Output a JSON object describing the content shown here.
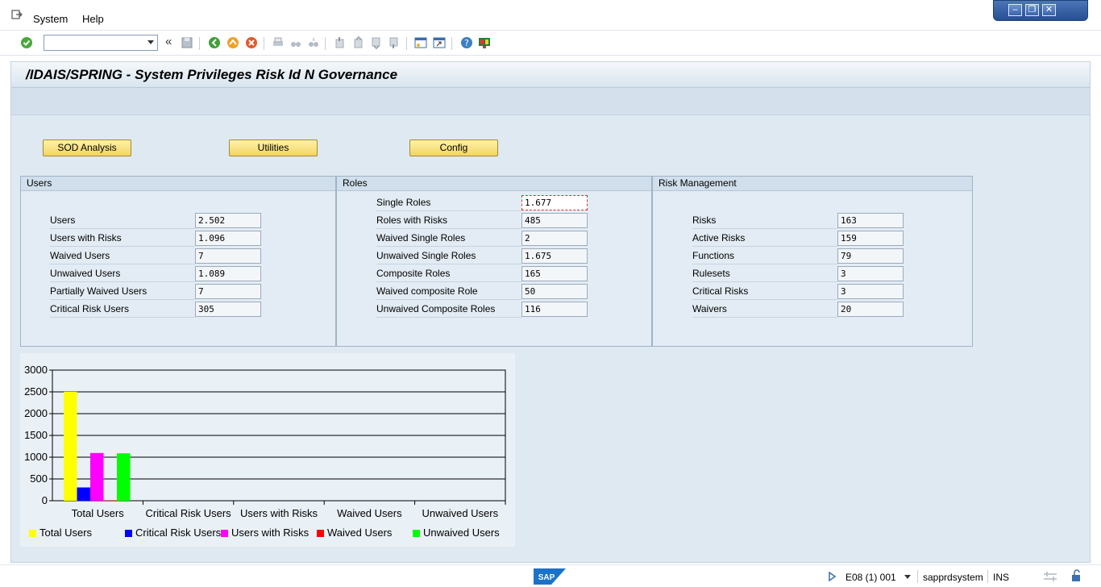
{
  "menu": {
    "system": "System",
    "help": "Help"
  },
  "window_controls": {
    "minimize": "–",
    "restore": "❐",
    "close": "✕"
  },
  "command_field": {
    "value": ""
  },
  "header": {
    "title": "/IDAIS/SPRING - System Privileges Risk Id N Governance"
  },
  "buttons": {
    "sod": "SOD Analysis",
    "utilities": "Utilities",
    "config": "Config"
  },
  "users": {
    "heading": "Users",
    "rows": [
      {
        "label": "Users",
        "value": "2.502"
      },
      {
        "label": "Users with Risks",
        "value": "1.096"
      },
      {
        "label": "Waived Users",
        "value": "7"
      },
      {
        "label": "Unwaived Users",
        "value": "1.089"
      },
      {
        "label": "Partially Waived Users",
        "value": "7"
      },
      {
        "label": "Critical Risk Users",
        "value": "305"
      }
    ]
  },
  "roles": {
    "heading": "Roles",
    "rows": [
      {
        "label": "Single Roles",
        "value": "1.677"
      },
      {
        "label": "Roles with Risks",
        "value": "485"
      },
      {
        "label": "Waived Single Roles",
        "value": "2"
      },
      {
        "label": "Unwaived Single Roles",
        "value": "1.675"
      },
      {
        "label": "Composite Roles",
        "value": "165"
      },
      {
        "label": "Waived composite Role",
        "value": "50"
      },
      {
        "label": "Unwaived Composite Roles",
        "value": "116"
      }
    ]
  },
  "risk": {
    "heading": "Risk Management",
    "rows": [
      {
        "label": "Risks",
        "value": "163"
      },
      {
        "label": "Active Risks",
        "value": "159"
      },
      {
        "label": "Functions",
        "value": "79"
      },
      {
        "label": "Rulesets",
        "value": "3"
      },
      {
        "label": "Critical Risks",
        "value": "3"
      },
      {
        "label": "Waivers",
        "value": "20"
      }
    ]
  },
  "chart_data": {
    "type": "bar",
    "categories": [
      "Total Users",
      "Critical Risk Users",
      "Users with Risks",
      "Waived Users",
      "Unwaived Users"
    ],
    "series": [
      {
        "name": "Total Users",
        "color": "#ffff00",
        "values": [
          2502,
          0,
          0,
          0,
          0
        ]
      },
      {
        "name": "Critical Risk Users",
        "color": "#0000ff",
        "values": [
          305,
          0,
          0,
          0,
          0
        ]
      },
      {
        "name": "Users with Risks",
        "color": "#ff00ff",
        "values": [
          1096,
          0,
          0,
          0,
          0
        ]
      },
      {
        "name": "Waived Users",
        "color": "#ff0000",
        "values": [
          7,
          0,
          0,
          0,
          0
        ]
      },
      {
        "name": "Unwaived Users",
        "color": "#00ff00",
        "values": [
          1089,
          0,
          0,
          0,
          0
        ]
      }
    ],
    "yticks": [
      "0",
      "500",
      "1000",
      "1500",
      "2000",
      "2500",
      "3000"
    ],
    "ylim": [
      0,
      3000
    ],
    "grid": true,
    "legend": "bottom"
  },
  "status": {
    "session": "E08 (1) 001",
    "server": "sapprdsystem",
    "mode": "INS",
    "logo": "SAP"
  }
}
